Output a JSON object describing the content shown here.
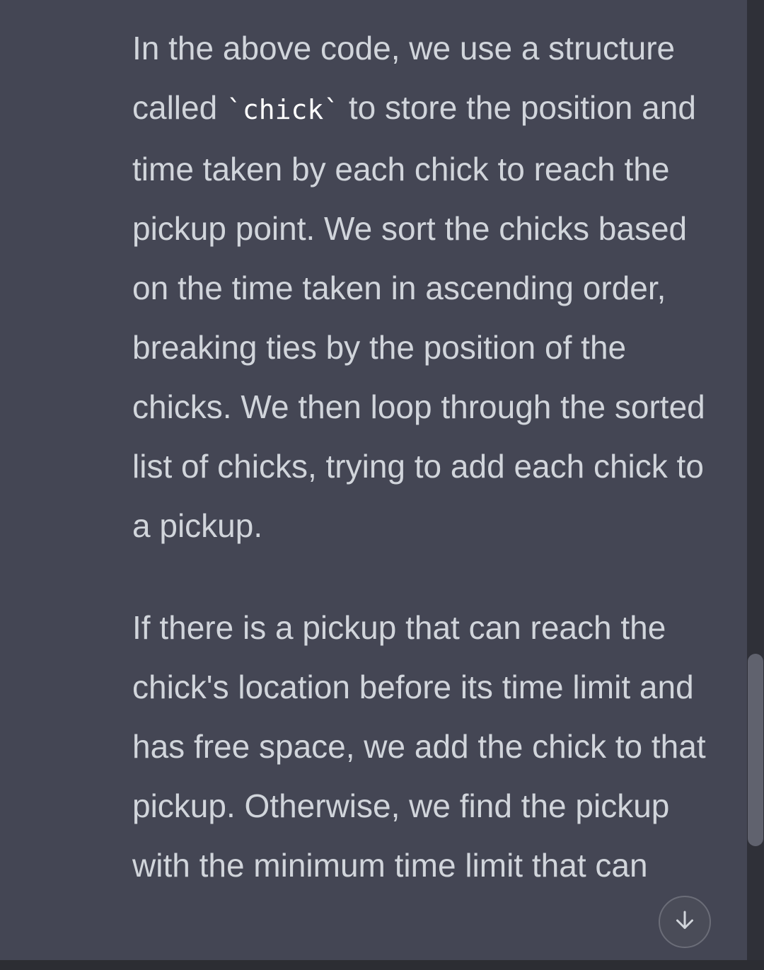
{
  "message": {
    "p1_a": "In the above code, we use a structure called ",
    "p1_code": "`chick`",
    "p1_b": " to store the position and time taken by each chick to reach the pickup point. We sort the chicks based on the time taken in ascending order, breaking ties by the position of the chicks. We then loop through the sorted list of chicks, trying to add each chick to a pickup.",
    "p2": "If there is a pickup that can reach the chick's location before its time limit and has free space, we add the chick to that pickup. Otherwise, we find the pickup with the minimum time limit that can"
  },
  "scroll_button": {
    "icon": "arrow-down-icon"
  },
  "colors": {
    "background": "#444654",
    "text": "#d1d5db",
    "code": "#ffffff"
  }
}
